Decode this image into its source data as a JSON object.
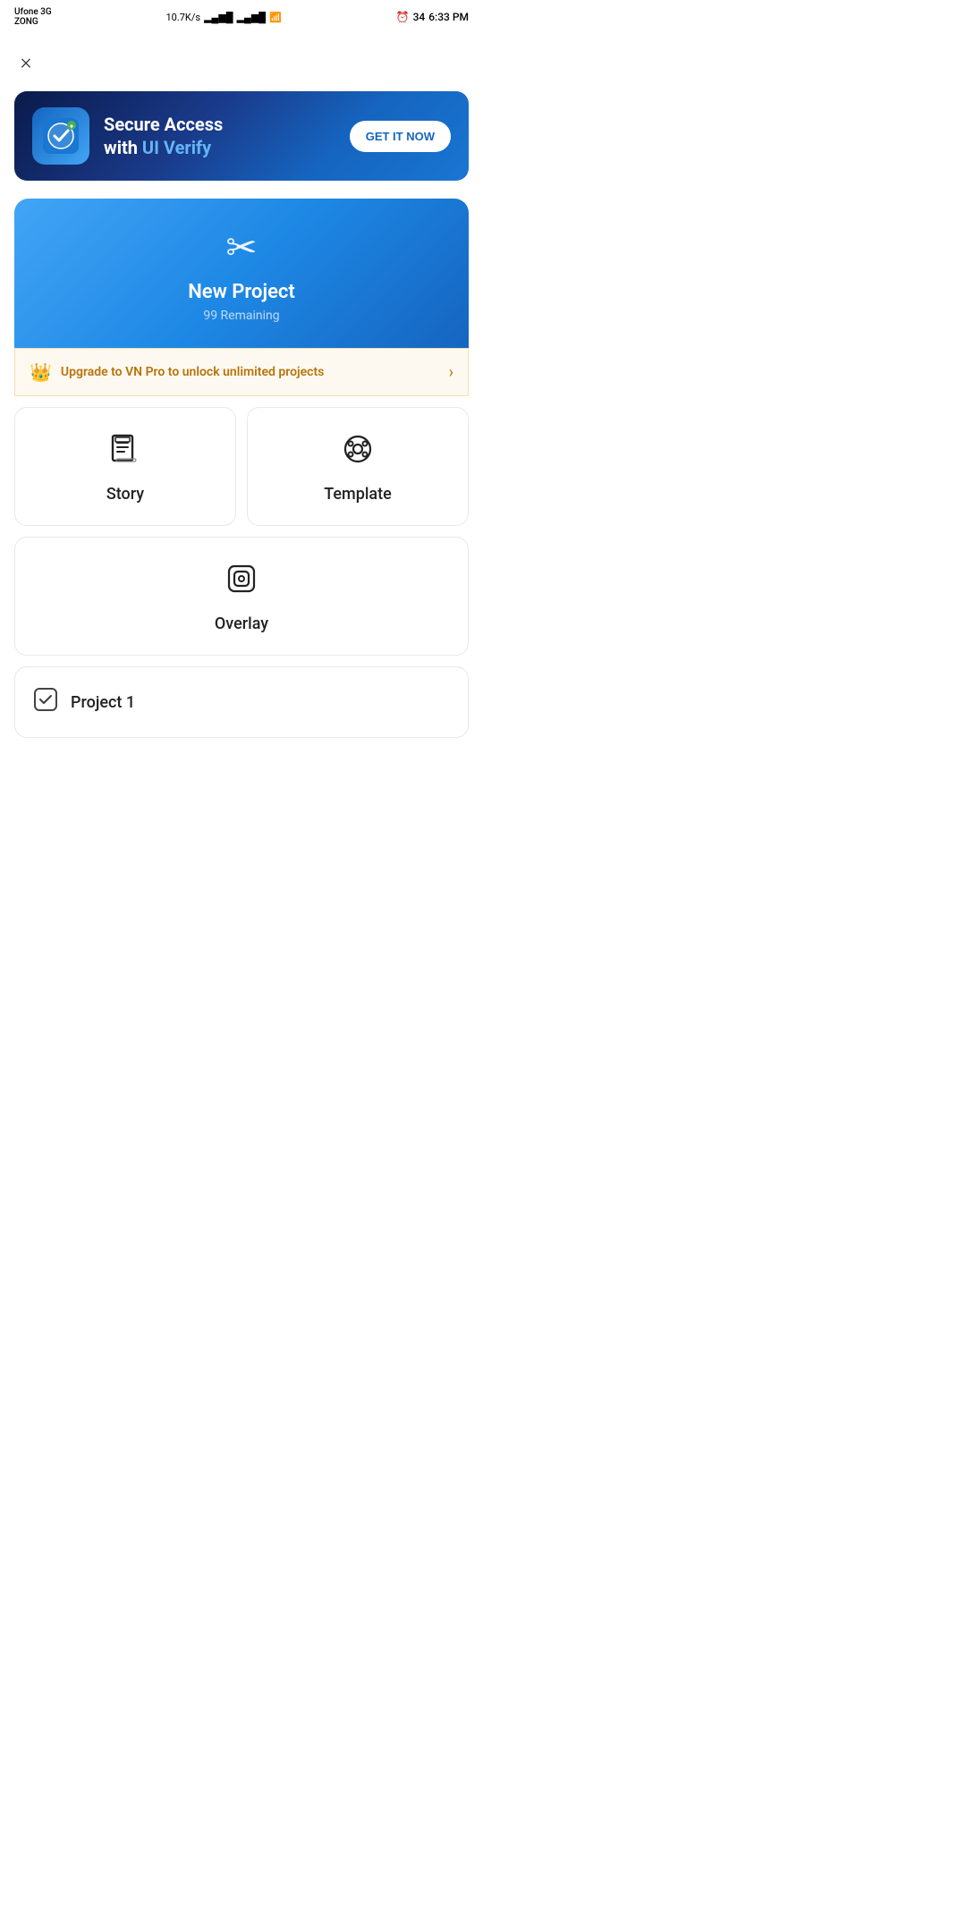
{
  "statusBar": {
    "carrier": "Ufone 3G",
    "carrier2": "ZONG",
    "signal": "10.7K/s",
    "time": "6:33 PM",
    "battery": "34"
  },
  "close": {
    "icon": "×"
  },
  "adBanner": {
    "title": "Secure Access",
    "subtitle_plain": "with ",
    "subtitle_colored": "UI Verify",
    "cta": "GET IT NOW"
  },
  "newProject": {
    "icon": "✂",
    "title": "New Project",
    "remaining": "99 Remaining"
  },
  "upgrade": {
    "crown": "👑",
    "text": "Upgrade to VN Pro to unlock unlimited projects",
    "chevron": "›"
  },
  "projectTypes": [
    {
      "icon": "story",
      "label": "Story"
    },
    {
      "icon": "template",
      "label": "Template"
    }
  ],
  "overlay": {
    "label": "Overlay"
  },
  "project1": {
    "label": "Project 1"
  }
}
